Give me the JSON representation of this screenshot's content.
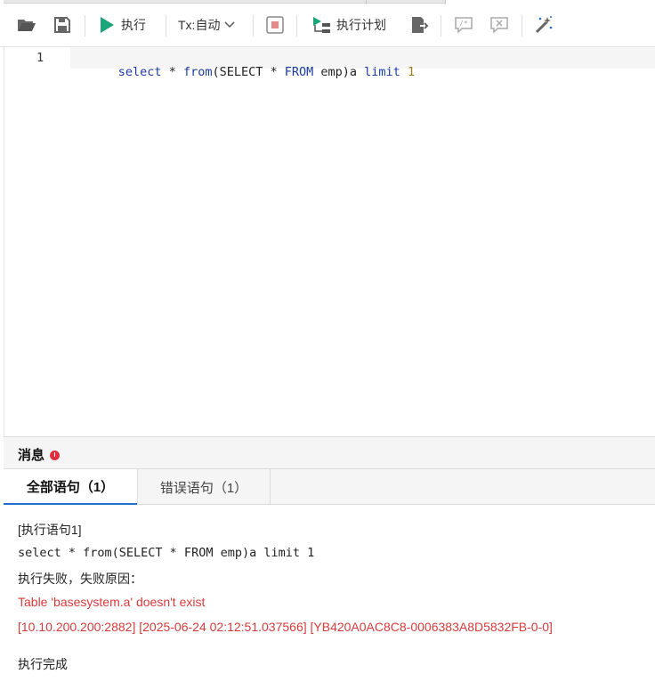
{
  "toolbar": {
    "run_label": "执行",
    "tx_label": "Tx:自动",
    "plan_label": "执行计划"
  },
  "editor": {
    "line_number": "1",
    "tokens": [
      {
        "text": "select",
        "kind": "kw"
      },
      {
        "text": " * ",
        "kind": "plain"
      },
      {
        "text": "from",
        "kind": "kw"
      },
      {
        "text": "(SELECT * ",
        "kind": "plain"
      },
      {
        "text": "FROM",
        "kind": "kw"
      },
      {
        "text": " emp)a ",
        "kind": "plain"
      },
      {
        "text": "limit",
        "kind": "kw"
      },
      {
        "text": " ",
        "kind": "plain"
      },
      {
        "text": "1",
        "kind": "num"
      }
    ]
  },
  "messages": {
    "title": "消息",
    "tabs": [
      {
        "label": "全部语句（1）"
      },
      {
        "label": "错误语句（1）"
      }
    ],
    "output": {
      "stmt_header": "[执行语句1]",
      "stmt_sql": "select * from(SELECT * FROM emp)a limit 1",
      "fail_label": "执行失败，失败原因：",
      "error_message": "Table 'basesystem.a' doesn't exist",
      "error_detail": "[10.10.200.200:2882] [2025-06-24 02:12:51.037566] [YB420A0AC8C8-0006383A8D5832FB-0-0]",
      "done_label": "执行完成"
    }
  },
  "colors": {
    "run_icon": "#1aa57a",
    "keyword": "#1a3aa3",
    "number": "#9a7b16",
    "error_text": "#d73a3a",
    "error_badge": "#e0303f",
    "active_tab_underline": "#1f6fd1"
  },
  "icons": [
    "folder-open-icon",
    "save-icon",
    "play-icon",
    "chevron-down-icon",
    "stop-icon",
    "execution-plan-icon",
    "export-icon",
    "comment-icon",
    "uncomment-icon",
    "magic-wand-icon"
  ]
}
